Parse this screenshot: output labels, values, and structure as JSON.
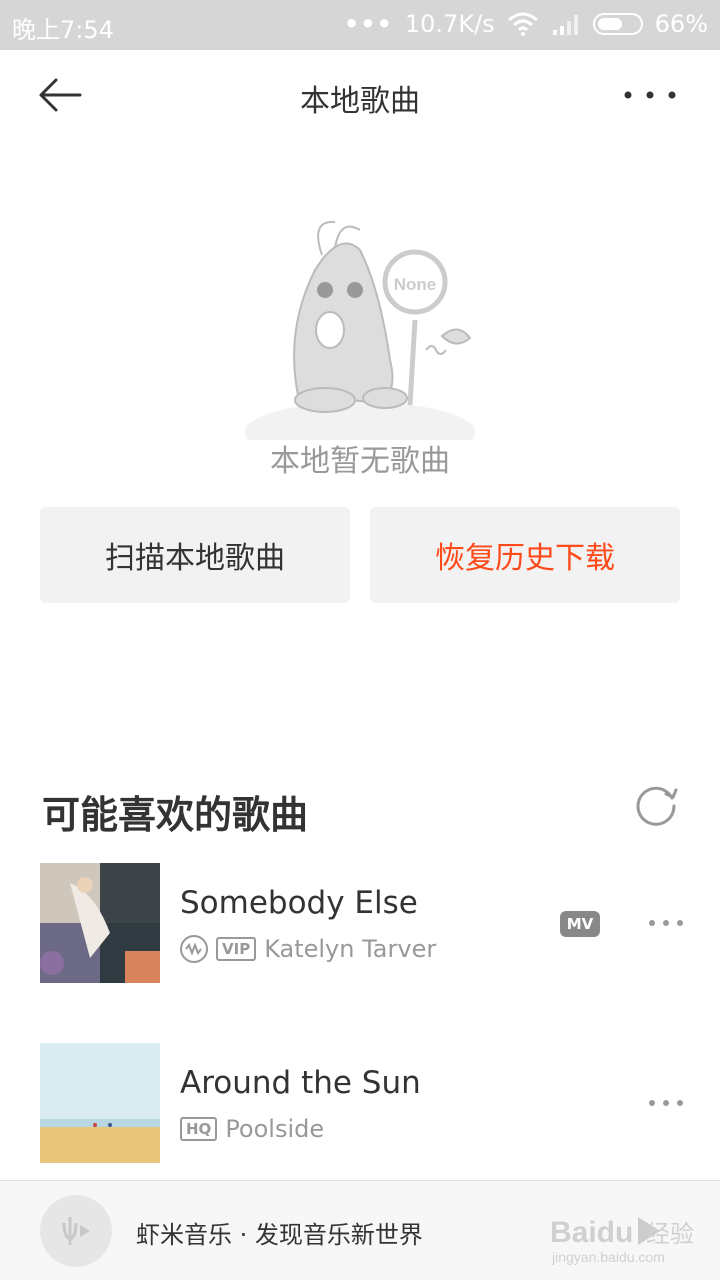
{
  "status_bar": {
    "time": "晚上7:54",
    "speed": "10.7K/s",
    "battery": "66%",
    "battery_level": 0.66
  },
  "header": {
    "title": "本地歌曲",
    "back_icon": "back-arrow-icon",
    "more_icon": "more-dots-icon"
  },
  "empty_state": {
    "illustration_label": "None",
    "message": "本地暂无歌曲"
  },
  "actions": {
    "scan": "扫描本地歌曲",
    "restore": "恢复历史下载",
    "restore_color": "#ff4a1a"
  },
  "recommend": {
    "title": "可能喜欢的歌曲",
    "refresh_icon": "refresh-icon",
    "songs": [
      {
        "title": "Somebody Else",
        "artist": "Katelyn Tarver",
        "badges": [
          "VIP"
        ],
        "mv": "MV"
      },
      {
        "title": "Around the Sun",
        "artist": "Poolside",
        "badges": [
          "HQ"
        ]
      }
    ]
  },
  "player": {
    "text": "虾米音乐 · 发现音乐新世界",
    "play_icon": "play-icon"
  },
  "watermark": {
    "brand": "Baidu",
    "sub": "经验",
    "url": "jingyan.baidu.com"
  }
}
